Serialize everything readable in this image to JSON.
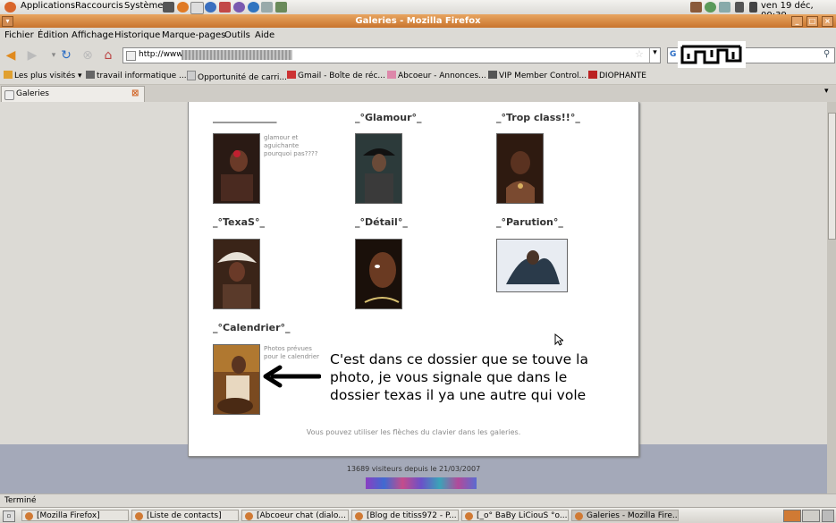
{
  "top_panel": {
    "menus": [
      "Applications",
      "Raccourcis",
      "Système"
    ],
    "clock": "ven 19 déc, 00:39"
  },
  "window": {
    "title": "Galeries - Mozilla Firefox"
  },
  "menubar": [
    "Fichier",
    "Édition",
    "Affichage",
    "Historique",
    "Marque-pages",
    "Outils",
    "Aide"
  ],
  "nav": {
    "url": "http://www.t"
  },
  "bookmarks": [
    "Les plus visités",
    "travail informatique ...",
    "Opportunité de carri...",
    "Gmail - Boîte de réc...",
    "Abcoeur - Annonces...",
    "VIP Member Control...",
    "DIOPHANTE"
  ],
  "tab": {
    "label": "Galeries"
  },
  "galleries": [
    {
      "title": "_____________",
      "desc": "glamour et aguichante pourquoi pas????"
    },
    {
      "title": "_°Glamour°_",
      "desc": ""
    },
    {
      "title": "_°Trop class!!°_",
      "desc": ""
    },
    {
      "title": "_°TexaS°_",
      "desc": ""
    },
    {
      "title": "_°Détail°_",
      "desc": ""
    },
    {
      "title": "_°Parution°_",
      "desc": ""
    },
    {
      "title": "_°Calendrier°_",
      "desc": "Photos prévues pour le calendrier"
    }
  ],
  "annotation": "C'est dans ce dossier que se touve la photo, je vous signale que dans le dossier texas il ya une autre qui vole",
  "hint": "Vous pouvez utiliser les flèches du clavier dans les galeries.",
  "visitors": "13689 visiteurs depuis le 21/03/2007",
  "status": "Terminé",
  "taskbar": [
    "[Mozilla Firefox]",
    "[Liste de contacts]",
    "[Abcoeur chat (dialo...",
    "[Blog de titiss972 - P...",
    "[_o° BaBy LiCiouS °o...",
    "Galeries - Mozilla Fire..."
  ]
}
